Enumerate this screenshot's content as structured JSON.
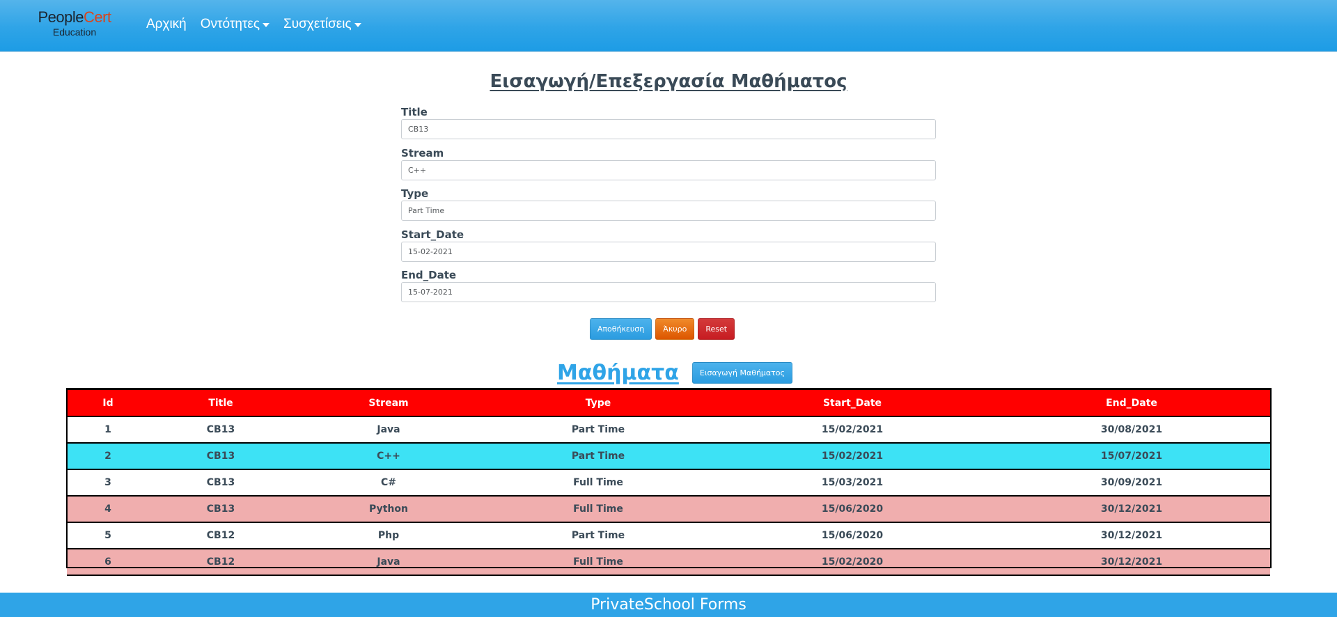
{
  "navbar": {
    "brand_people": "People",
    "brand_cert": "Cert",
    "brand_sub": "Education",
    "items": [
      {
        "label": "Αρχική",
        "dropdown": false
      },
      {
        "label": "Οντότητες",
        "dropdown": true
      },
      {
        "label": "Συσχετίσεις",
        "dropdown": true
      }
    ]
  },
  "form": {
    "title": "Εισαγωγή/Επεξεργασία Μαθήματος",
    "fields": [
      {
        "label": "Title",
        "value": "CB13"
      },
      {
        "label": "Stream",
        "value": "C++"
      },
      {
        "label": "Type",
        "value": "Part Time"
      },
      {
        "label": "Start_Date",
        "value": "15-02-2021"
      },
      {
        "label": "End_Date",
        "value": "15-07-2021"
      }
    ],
    "buttons": {
      "save": "Αποθήκευση",
      "cancel": "Άκυρο",
      "reset": "Reset"
    }
  },
  "courses": {
    "title": "Μαθήματα",
    "add_button": "Εισαγωγή Μαθήματος",
    "columns": [
      "Id",
      "Title",
      "Stream",
      "Type",
      "Start_Date",
      "End_Date"
    ],
    "rows": [
      {
        "id": "1",
        "title": "CB13",
        "stream": "Java",
        "type": "Part Time",
        "start": "15/02/2021",
        "end": "30/08/2021",
        "style": "white"
      },
      {
        "id": "2",
        "title": "CB13",
        "stream": "C++",
        "type": "Part Time",
        "start": "15/02/2021",
        "end": "15/07/2021",
        "style": "cyan"
      },
      {
        "id": "3",
        "title": "CB13",
        "stream": "C#",
        "type": "Full Time",
        "start": "15/03/2021",
        "end": "30/09/2021",
        "style": "white"
      },
      {
        "id": "4",
        "title": "CB13",
        "stream": "Python",
        "type": "Full Time",
        "start": "15/06/2020",
        "end": "30/12/2021",
        "style": "pink"
      },
      {
        "id": "5",
        "title": "CB12",
        "stream": "Php",
        "type": "Part Time",
        "start": "15/06/2020",
        "end": "30/12/2021",
        "style": "white"
      },
      {
        "id": "6",
        "title": "CB12",
        "stream": "Java",
        "type": "Full Time",
        "start": "15/02/2020",
        "end": "30/12/2021",
        "style": "pink"
      }
    ]
  },
  "footer": {
    "text": "PrivateSchool Forms"
  },
  "colors": {
    "navbar": "#2fa4e7",
    "header_row": "#ff0000",
    "selected_row": "#3de2f5",
    "alt_row": "#f0aeae",
    "cancel_button": "#dd5600",
    "reset_button": "#c71c22"
  }
}
